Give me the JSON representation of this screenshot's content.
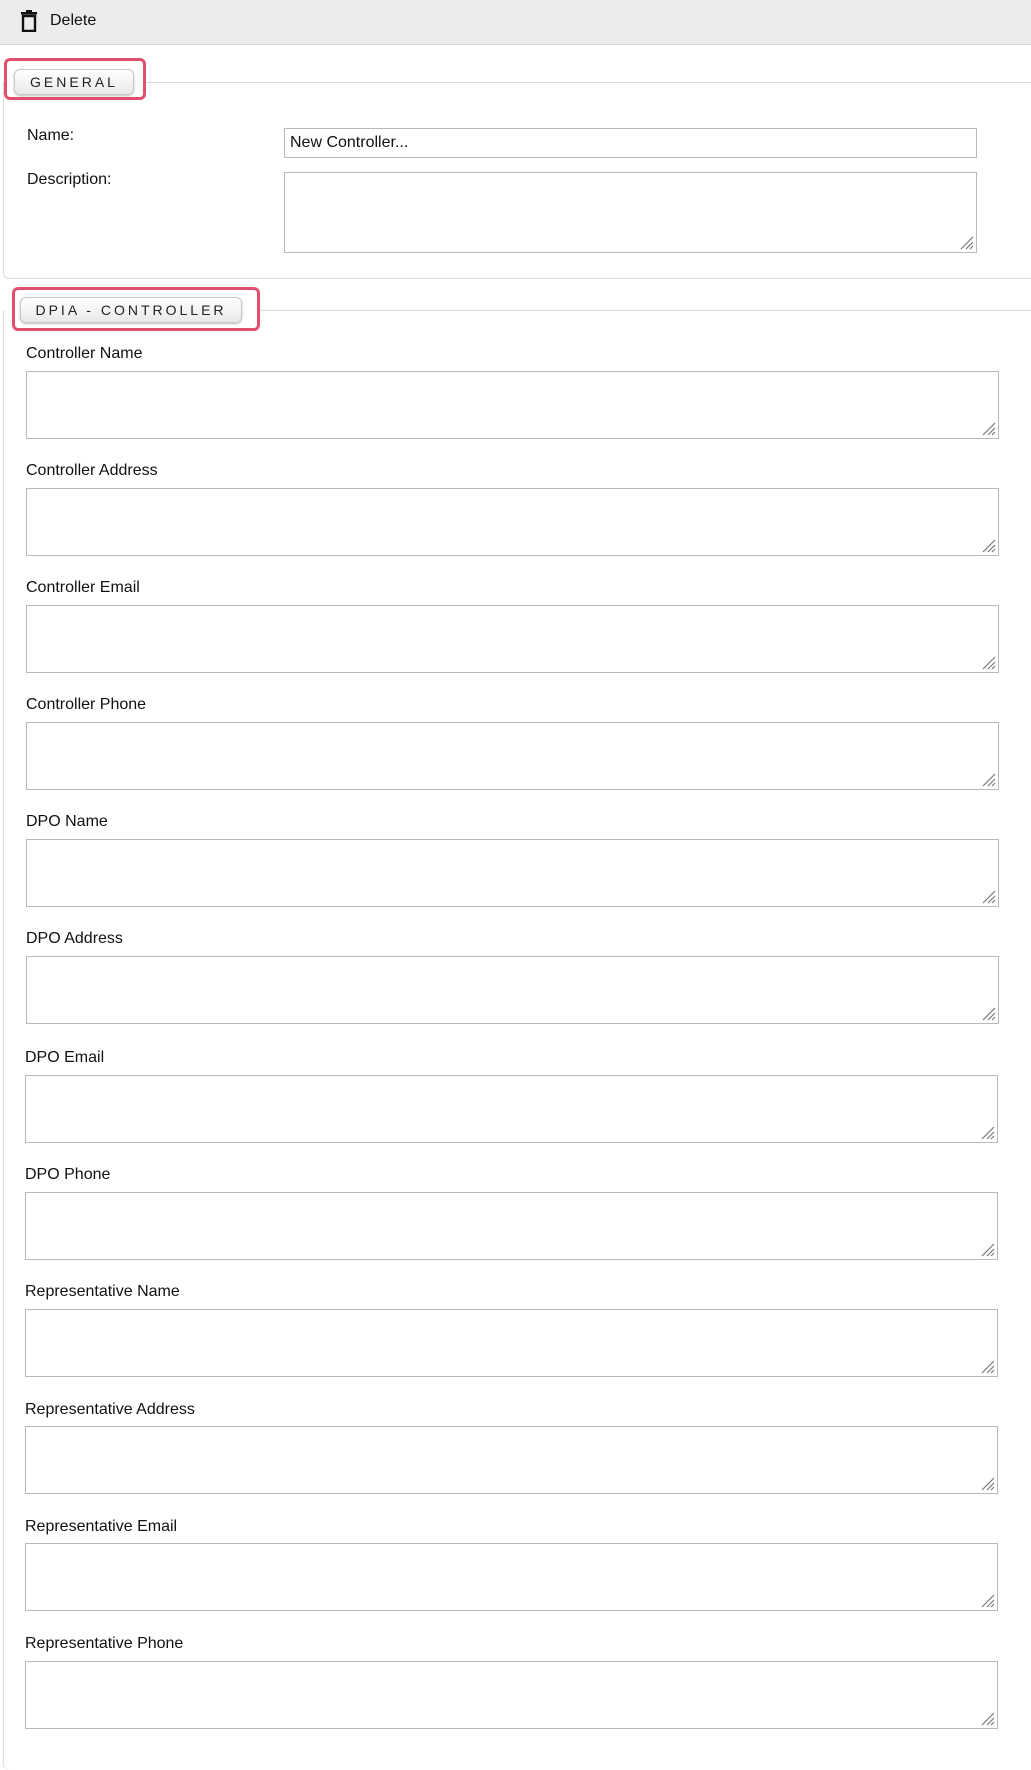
{
  "toolbar": {
    "delete_label": "Delete",
    "delete_icon": "trash-icon"
  },
  "general": {
    "legend": "GENERAL",
    "name_label": "Name:",
    "name_value": "New Controller...",
    "description_label": "Description:",
    "description_value": ""
  },
  "controller": {
    "legend": "DPIA - CONTROLLER",
    "fields": [
      {
        "label": "Controller Name",
        "value": ""
      },
      {
        "label": "Controller Address",
        "value": ""
      },
      {
        "label": "Controller Email",
        "value": ""
      },
      {
        "label": "Controller Phone",
        "value": ""
      },
      {
        "label": "DPO Name",
        "value": ""
      },
      {
        "label": "DPO Address",
        "value": ""
      },
      {
        "label": "DPO Email",
        "value": ""
      },
      {
        "label": "DPO Phone",
        "value": ""
      },
      {
        "label": "Representative Name",
        "value": ""
      },
      {
        "label": "Representative Address",
        "value": ""
      },
      {
        "label": "Representative Email",
        "value": ""
      },
      {
        "label": "Representative Phone",
        "value": ""
      }
    ]
  },
  "colors": {
    "highlight": "#e0506e",
    "toolbar_bg": "#ececec",
    "border": "#b8b8b8"
  }
}
